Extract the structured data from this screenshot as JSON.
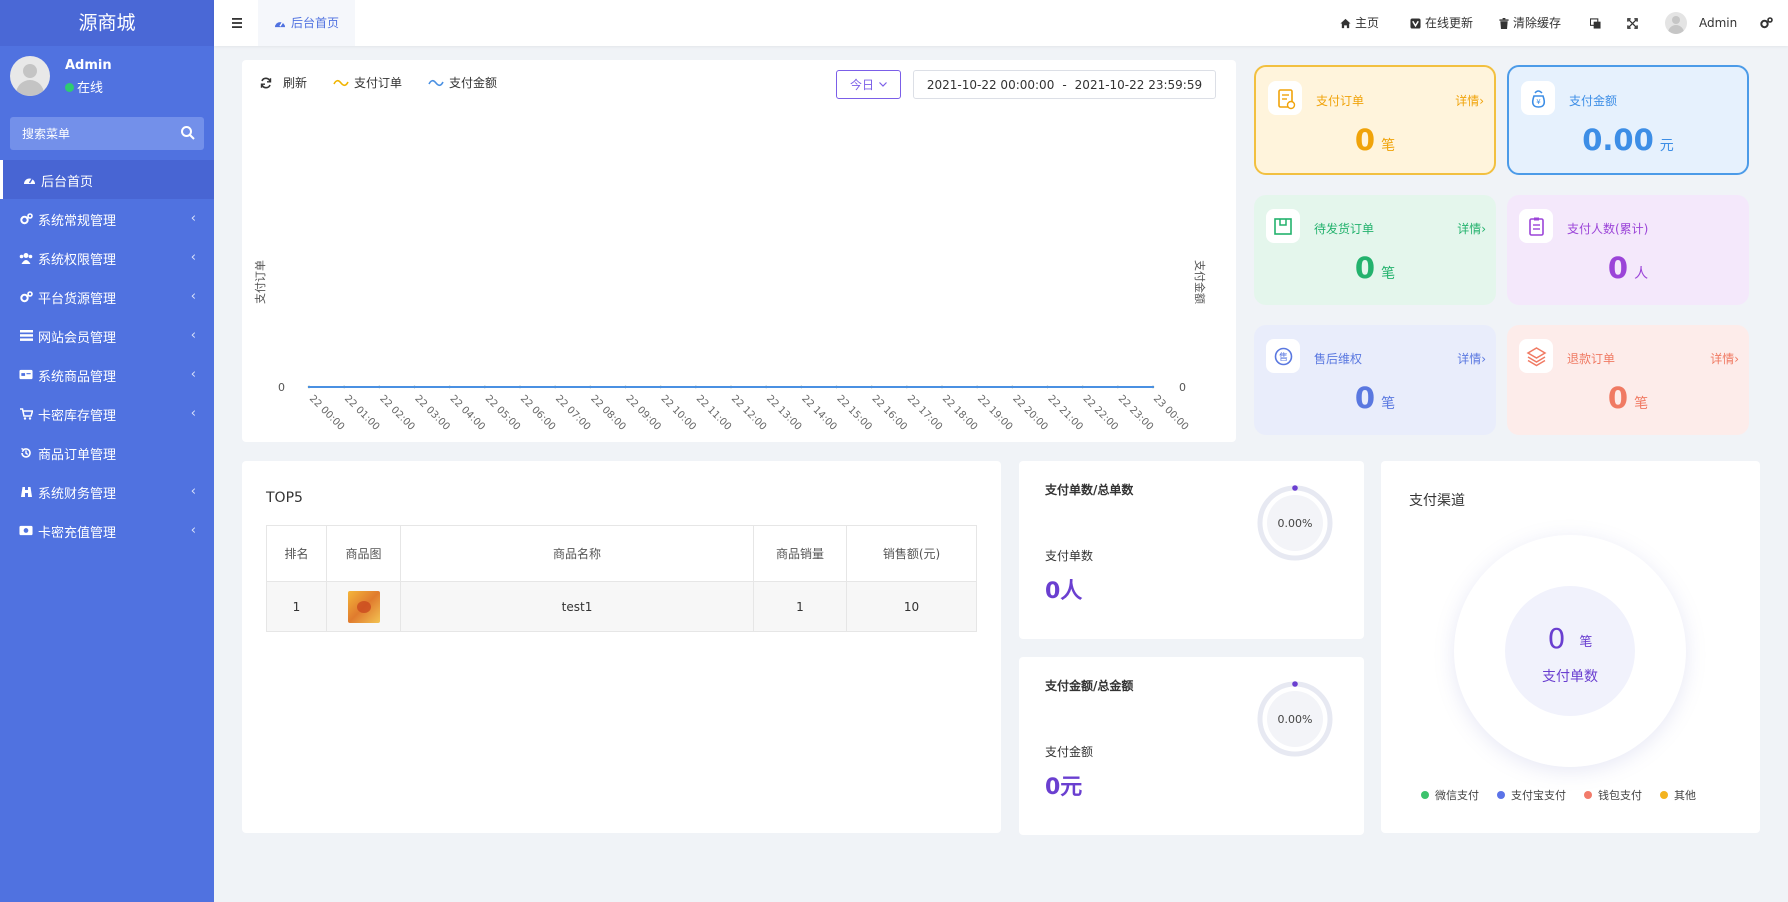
{
  "brand": "源商城",
  "user": {
    "name": "Admin",
    "status": "在线"
  },
  "search": {
    "placeholder": "搜索菜单"
  },
  "menu": [
    {
      "label": "后台首页",
      "icon": "dashboard-icon",
      "active": true,
      "has_children": false
    },
    {
      "label": "系统常规管理",
      "icon": "cogs-icon",
      "has_children": true
    },
    {
      "label": "系统权限管理",
      "icon": "users-icon",
      "has_children": true
    },
    {
      "label": "平台货源管理",
      "icon": "cogs-icon",
      "has_children": true
    },
    {
      "label": "网站会员管理",
      "icon": "list-icon",
      "has_children": true
    },
    {
      "label": "系统商品管理",
      "icon": "card-icon",
      "has_children": true
    },
    {
      "label": "卡密库存管理",
      "icon": "cart-icon",
      "has_children": true
    },
    {
      "label": "商品订单管理",
      "icon": "history-icon",
      "has_children": false
    },
    {
      "label": "系统财务管理",
      "icon": "binoculars-icon",
      "has_children": true
    },
    {
      "label": "卡密充值管理",
      "icon": "money-icon",
      "has_children": true
    }
  ],
  "header": {
    "tab": "后台首页",
    "links": [
      "主页",
      "在线更新",
      "清除缓存"
    ],
    "admin": "Admin"
  },
  "chart_panel": {
    "refresh": "刷新",
    "legend": [
      "支付订单",
      "支付金额"
    ],
    "period": "今日",
    "date_start": "2021-10-22 00:00:00",
    "date_sep": "-",
    "date_end": "2021-10-22 23:59:59"
  },
  "chart_data": {
    "type": "line",
    "x": [
      "22 00:00",
      "22 01:00",
      "22 02:00",
      "22 03:00",
      "22 04:00",
      "22 05:00",
      "22 06:00",
      "22 07:00",
      "22 08:00",
      "22 09:00",
      "22 10:00",
      "22 11:00",
      "22 12:00",
      "22 13:00",
      "22 14:00",
      "22 15:00",
      "22 16:00",
      "22 17:00",
      "22 18:00",
      "22 19:00",
      "22 20:00",
      "22 21:00",
      "22 22:00",
      "22 23:00",
      "23 00:00"
    ],
    "series": [
      {
        "name": "支付订单",
        "values": [
          0,
          0,
          0,
          0,
          0,
          0,
          0,
          0,
          0,
          0,
          0,
          0,
          0,
          0,
          0,
          0,
          0,
          0,
          0,
          0,
          0,
          0,
          0,
          0,
          0
        ],
        "color": "#f0b400"
      },
      {
        "name": "支付金额",
        "values": [
          0,
          0,
          0,
          0,
          0,
          0,
          0,
          0,
          0,
          0,
          0,
          0,
          0,
          0,
          0,
          0,
          0,
          0,
          0,
          0,
          0,
          0,
          0,
          0,
          0
        ],
        "color": "#4a90e2"
      }
    ],
    "ylabel_left": "支付订单",
    "ylabel_right": "支付金额",
    "left_tick": "0",
    "right_tick": "0"
  },
  "stats": [
    {
      "title": "支付订单",
      "detail": "详情›",
      "value": "0",
      "unit": "笔",
      "color": "#f0a30a",
      "bg": "#fff4dc",
      "border": "#f2c040",
      "icon": "clipboard-icon"
    },
    {
      "title": "支付金额",
      "detail": "",
      "value": "0.00",
      "unit": "元",
      "color": "#3d8ee6",
      "bg": "#e6f1fd",
      "border": "#4c9be8",
      "icon": "money-bag-icon"
    },
    {
      "title": "待发货订单",
      "detail": "详情›",
      "value": "0",
      "unit": "笔",
      "color": "#23b26d",
      "bg": "#e4f6ec",
      "border": "",
      "icon": "box-icon"
    },
    {
      "title": "支付人数(累计)",
      "detail": "",
      "value": "0",
      "unit": "人",
      "color": "#9b44d8",
      "bg": "#f4e8fb",
      "border": "",
      "icon": "list-icon"
    },
    {
      "title": "售后维权",
      "detail": "详情›",
      "value": "0",
      "unit": "笔",
      "color": "#5a78e0",
      "bg": "#e9edfb",
      "border": "",
      "icon": "after-sale-icon"
    },
    {
      "title": "退款订单",
      "detail": "详情›",
      "value": "0",
      "unit": "笔",
      "color": "#f07a63",
      "bg": "#fdecea",
      "border": "",
      "icon": "layers-icon"
    }
  ],
  "top5": {
    "title": "TOP5",
    "headers": [
      "排名",
      "商品图",
      "商品名称",
      "商品销量",
      "销售额(元)"
    ],
    "rows": [
      {
        "rank": "1",
        "name": "test1",
        "sales": "1",
        "amount": "10"
      }
    ]
  },
  "ratios": [
    {
      "title": "支付单数/总单数",
      "label": "支付单数",
      "value": "0人",
      "percent": "0.00%"
    },
    {
      "title": "支付金额/总金额",
      "label": "支付金额",
      "value": "0元",
      "percent": "0.00%"
    }
  ],
  "channels": {
    "title": "支付渠道",
    "count": "0",
    "unit": "笔",
    "label": "支付单数",
    "legend": [
      {
        "name": "微信支付",
        "color": "#3cc36c"
      },
      {
        "name": "支付宝支付",
        "color": "#5b73e8"
      },
      {
        "name": "钱包支付",
        "color": "#f27b6a"
      },
      {
        "name": "其他",
        "color": "#f3b31f"
      }
    ]
  }
}
